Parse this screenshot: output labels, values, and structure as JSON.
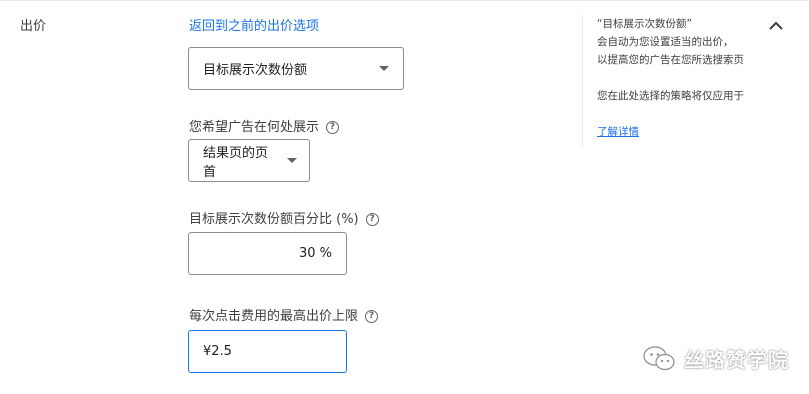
{
  "bid": {
    "section_label": "出价",
    "back_link": "返回到之前的出价选项",
    "strategy_select": "目标展示次数份额",
    "where_label": "您希望广告在何处展示",
    "where_select": "结果页的页首",
    "pct_label": "目标展示次数份额百分比 (%)",
    "pct_value": "30 %",
    "cpc_label": "每次点击费用的最高出价上限",
    "cpc_value": "¥2.5",
    "help_glyph": "?"
  },
  "info_panel": {
    "title": "“目标展示次数份额”",
    "line1": "会自动为您设置适当的出价，",
    "line2": "以提高您的广告在您所选搜索页",
    "line3": "您在此处选择的策略将仅应用于",
    "learn_more": "了解详情"
  },
  "watermark": {
    "text": "丝路赞学院"
  },
  "icons": {
    "collapse": "chevron-up-icon",
    "dropdown": "triangle-down-icon",
    "help": "help-circle-icon",
    "watermark": "wechat-icon"
  },
  "colors": {
    "link": "#1a73e8",
    "focus_border": "#1a73e8"
  }
}
